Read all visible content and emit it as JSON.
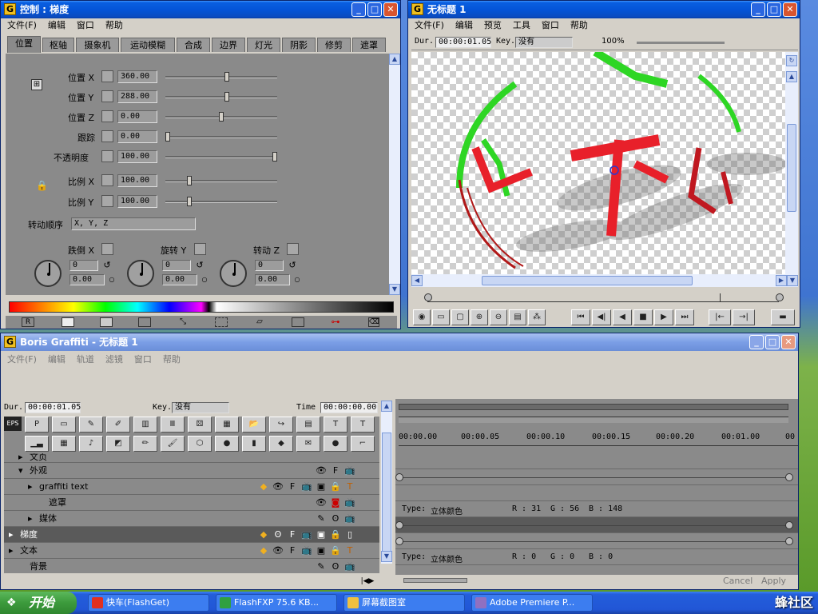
{
  "control": {
    "title": "控制 : 梯度",
    "menu": [
      "文件(F)",
      "编辑",
      "窗口",
      "帮助"
    ],
    "tabs": [
      "位置",
      "枢轴",
      "摄象机",
      "运动模糊",
      "合成",
      "边界",
      "灯光",
      "阴影",
      "修剪",
      "遮罩"
    ],
    "rows": [
      {
        "label": "位置 X",
        "value": "360.00",
        "level": 0.55
      },
      {
        "label": "位置 Y",
        "value": "288.00",
        "level": 0.55
      },
      {
        "label": "位置 Z",
        "value": "0.00",
        "level": 0.5
      },
      {
        "label": "跟踪",
        "value": "0.00",
        "level": 0.0
      },
      {
        "label": "不透明度",
        "value": "100.00",
        "level": 1.0
      },
      {
        "label": "比例 X",
        "value": "100.00",
        "level": 0.2
      },
      {
        "label": "比例 Y",
        "value": "100.00",
        "level": 0.2
      }
    ],
    "rotation_order_label": "转动顺序",
    "rotation_order_value": "X, Y, Z",
    "rot_x_label": "跌倒 X",
    "rot_y_label": "旋转 Y",
    "rot_z_label": "转动 Z",
    "rot_values": [
      {
        "a": "0",
        "b": "0.00"
      },
      {
        "a": "0",
        "b": "0.00"
      },
      {
        "a": "0",
        "b": "0.00"
      }
    ],
    "bottom_r_label": "R"
  },
  "preview": {
    "title": "无标题  1",
    "menu": [
      "文件(F)",
      "编辑",
      "预览",
      "工具",
      "窗口",
      "帮助"
    ],
    "dur_label": "Dur.",
    "dur_value": "00:00:01.05",
    "key_label": "Key.",
    "key_value": "没有",
    "zoom": "100%"
  },
  "graffiti": {
    "title": "Boris Graffiti - 无标题 1",
    "menu": [
      "文件(F)",
      "编辑",
      "轨道",
      "滤镜",
      "窗口",
      "帮助"
    ],
    "dur_label": "Dur.",
    "dur_value": "00:00:01.05",
    "key_label": "Key.",
    "key_value": "没有",
    "time_label": "Time",
    "time_value": "00:00:00.00",
    "eps_label": "EPS",
    "timecodes": [
      "00:00.00",
      "00:00.05",
      "00:00.10",
      "00:00.15",
      "00:00.20",
      "00:01.00",
      "00"
    ],
    "layers": [
      {
        "name": "文页",
        "indent": 1
      },
      {
        "name": "外观",
        "indent": 1
      },
      {
        "name": "graffiti text",
        "indent": 2
      },
      {
        "name": "遮罩",
        "indent": 3
      },
      {
        "name": "媒体",
        "indent": 2
      },
      {
        "name": "梯度",
        "indent": 0
      },
      {
        "name": "文本",
        "indent": 0
      },
      {
        "name": "背景",
        "indent": 1
      }
    ],
    "track_type_label": "Type:",
    "track1": {
      "type": "立体颜色",
      "r": "R : 31",
      "g": "G : 56",
      "b": "B : 148"
    },
    "track2": {
      "type": "立体颜色",
      "r": "R : 0",
      "g": "G : 0",
      "b": "B : 0"
    },
    "cancel_label": "Cancel",
    "apply_label": "Apply"
  },
  "taskbar": {
    "start_label": "开始",
    "tasks": [
      "快车(FlashGet)",
      "FlashFXP 75.6 KB...",
      "屏幕截图室",
      "Adobe Premiere P..."
    ],
    "watermark": "蜂社区"
  },
  "colors": {
    "xp_blue": "#0a5fe0",
    "panel_gray": "#8a8a8a",
    "red_text": "#e8202a",
    "green_text": "#2ed624"
  }
}
